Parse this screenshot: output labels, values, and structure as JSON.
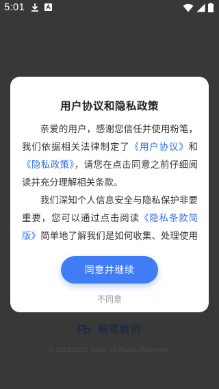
{
  "status_bar": {
    "time": "5:01",
    "icons": [
      "download-icon",
      "app-notification-icon",
      "wifi-icon",
      "signal-icon",
      "battery-icon"
    ]
  },
  "dialog": {
    "title": "用户协议和隐私政策",
    "paragraph1": {
      "text1": "亲爱的用户，感谢您信任并使用粉笔，我们依据相关法律制定了",
      "link1": "《用户协议》",
      "text2": "和",
      "link2": "《隐私政策》",
      "text3": "，请您在点击同意之前仔细阅读并充分理解相关条款。"
    },
    "paragraph2": {
      "text1": "我们深知个人信息安全与隐私保护非要重要，您可以通过点击阅读",
      "link1": "《隐私条款简版》",
      "text2": "简单地了解我们是如何收集、处理使用个人"
    },
    "agree_button": "同意并继续",
    "disagree_button": "不同意"
  },
  "footer": {
    "logo_text": "粉笔教师",
    "copyright": "© 2012-2025 fenbi. All Rights Reserved."
  },
  "colors": {
    "background_dim": "#383838",
    "dialog_bg": "#ffffff",
    "link": "#2f6fe8",
    "primary_button": "#3f7cf5",
    "secondary_text": "#9a9a9a"
  }
}
